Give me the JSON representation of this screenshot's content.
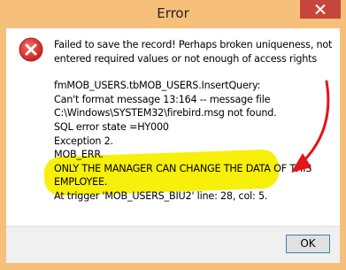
{
  "window": {
    "title": "Error",
    "close_glyph": "✕"
  },
  "icon": {
    "name": "error-icon",
    "color": "#d8302e"
  },
  "message": {
    "header_lines": [
      "Failed to save the record! Perhaps broken uniqueness, not",
      "entered required values or not enough of access rights"
    ],
    "detail_lines": [
      "fmMOB_USERS.tbMOB_USERS.InsertQuery:",
      "Can't format message 13:164 -- message file",
      "C:\\Windows\\SYSTEM32\\firebird.msg not found.",
      "SQL error state =HY000",
      "Exception 2.",
      "MOB_ERR."
    ],
    "highlight_lines": [
      "ONLY THE MANAGER CAN CHANGE THE DATA OF THIS",
      "EMPLOYEE."
    ],
    "trigger_line": "At trigger 'MOB_USERS_BIU2' line: 28, col: 5."
  },
  "footer": {
    "ok_label": "OK"
  },
  "annotation": {
    "highlight_color": "#f7f00a",
    "arrow_color": "#e3141a"
  }
}
